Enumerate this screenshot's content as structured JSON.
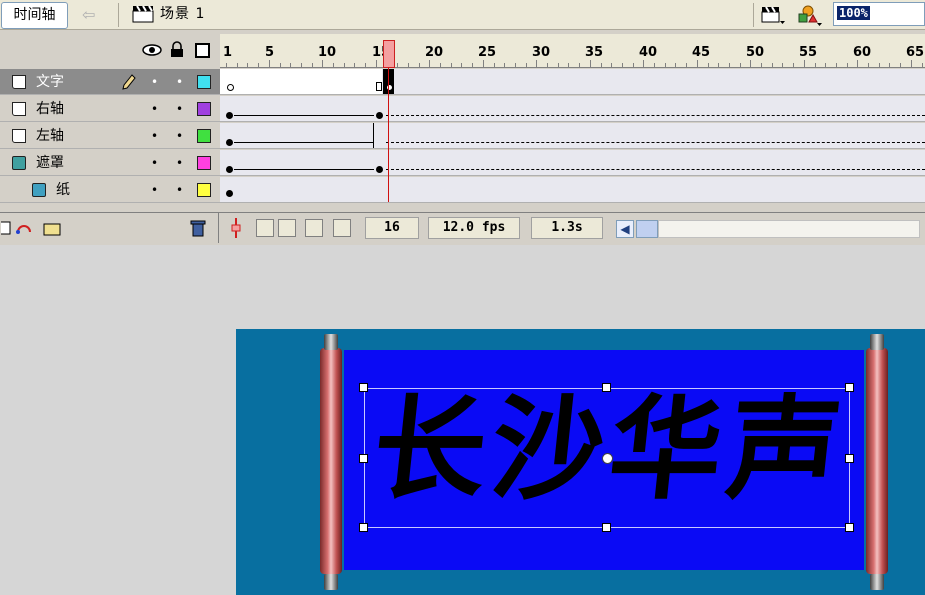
{
  "toolbar": {
    "timeline_label": "时间轴",
    "scene_label": "场景 1",
    "zoom_value": "100%"
  },
  "ruler": {
    "numbers": [
      "1",
      "5",
      "10",
      "15",
      "20",
      "25",
      "30",
      "35",
      "40",
      "45",
      "50",
      "55",
      "60",
      "65"
    ],
    "current_frame": 16
  },
  "layers": [
    {
      "name": "文字",
      "active": true,
      "color": "#40e0f0"
    },
    {
      "name": "右轴",
      "active": false,
      "color": "#a040e0"
    },
    {
      "name": "左轴",
      "active": false,
      "color": "#40e040"
    },
    {
      "name": "遮罩",
      "active": false,
      "color": "#ff40e0",
      "mask": true
    },
    {
      "name": "纸",
      "active": false,
      "color": "#ffff40",
      "masked": true
    }
  ],
  "status": {
    "frame": "16",
    "fps": "12.0 fps",
    "time": "1.3s"
  },
  "stage": {
    "text": "长沙华声",
    "stage_color": "#086fa0",
    "paper_color": "#0a0af5"
  },
  "icons": {
    "visibility": "eye-icon",
    "lock": "lock-icon",
    "outline": "outline-icon",
    "trash": "trash-icon",
    "pencil": "pencil-icon"
  }
}
